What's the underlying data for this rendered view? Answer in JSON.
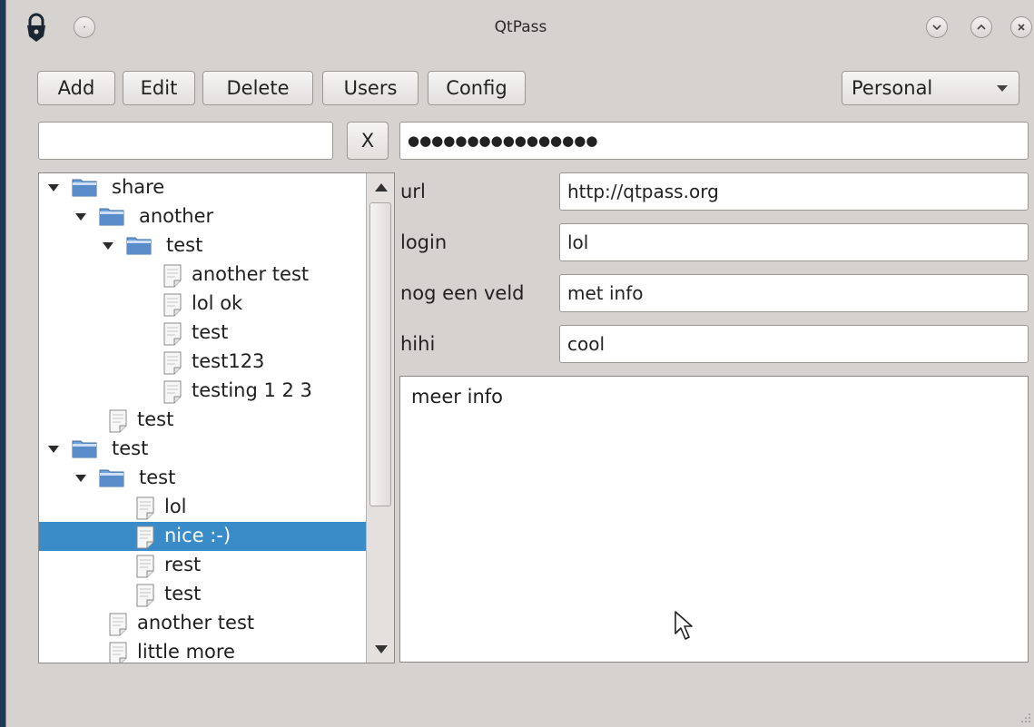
{
  "window": {
    "title": "QtPass"
  },
  "toolbar": {
    "add_label": "Add",
    "edit_label": "Edit",
    "delete_label": "Delete",
    "users_label": "Users",
    "config_label": "Config",
    "profile_selected": "Personal"
  },
  "search": {
    "value": "",
    "clear_label": "X"
  },
  "password_field": {
    "value": "●●●●●●●●●●●●●●●●"
  },
  "tree": {
    "items": [
      {
        "label": "share",
        "type": "folder",
        "depth": 0,
        "expanded": true
      },
      {
        "label": "another",
        "type": "folder",
        "depth": 1,
        "expanded": true
      },
      {
        "label": "test",
        "type": "folder",
        "depth": 2,
        "expanded": true
      },
      {
        "label": "another test",
        "type": "file",
        "depth": 3
      },
      {
        "label": "lol ok",
        "type": "file",
        "depth": 3
      },
      {
        "label": "test",
        "type": "file",
        "depth": 3
      },
      {
        "label": "test123",
        "type": "file",
        "depth": 3
      },
      {
        "label": "testing 1 2 3",
        "type": "file",
        "depth": 3
      },
      {
        "label": "test",
        "type": "file",
        "depth": 1
      },
      {
        "label": "test",
        "type": "folder",
        "depth": 0,
        "expanded": true
      },
      {
        "label": "test",
        "type": "folder",
        "depth": 1,
        "expanded": true
      },
      {
        "label": "lol",
        "type": "file",
        "depth": 2
      },
      {
        "label": "nice :-)",
        "type": "file",
        "depth": 2,
        "selected": true
      },
      {
        "label": "rest",
        "type": "file",
        "depth": 2
      },
      {
        "label": "test",
        "type": "file",
        "depth": 2
      },
      {
        "label": "another test",
        "type": "file",
        "depth": 1
      },
      {
        "label": "little more",
        "type": "file",
        "depth": 1
      }
    ]
  },
  "fields": [
    {
      "label": "url",
      "value": "http://qtpass.org"
    },
    {
      "label": "login",
      "value": "lol"
    },
    {
      "label": "nog een veld",
      "value": "met info"
    },
    {
      "label": "hihi",
      "value": "cool"
    }
  ],
  "notes": {
    "text": "meer info"
  },
  "colors": {
    "selection": "#3a8cc9",
    "window_bg": "#d6d2d0",
    "desktop_bg": "#1d3b57"
  }
}
